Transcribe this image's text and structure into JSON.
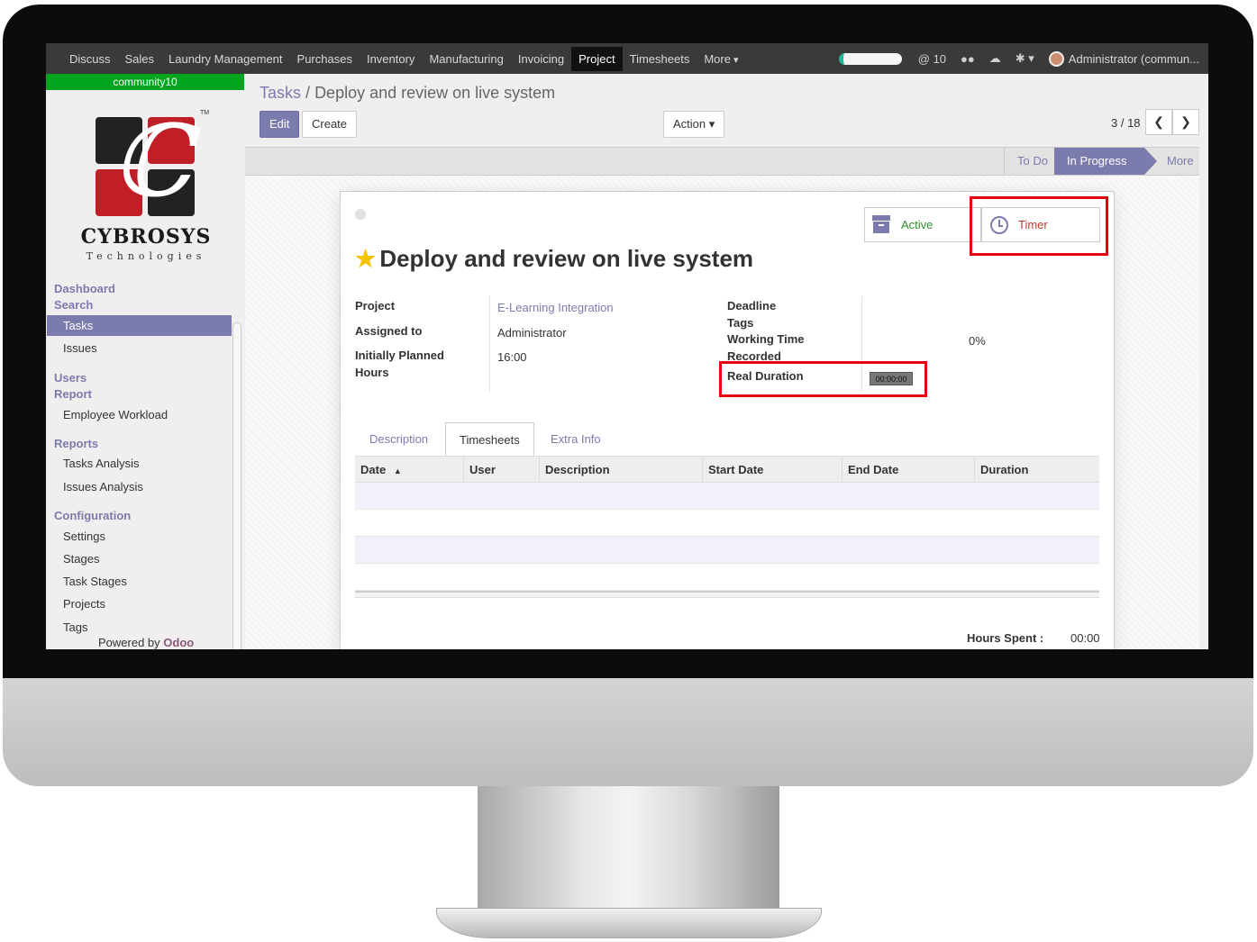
{
  "topbar": {
    "menu": [
      "Discuss",
      "Sales",
      "Laundry Management",
      "Purchases",
      "Inventory",
      "Manufacturing",
      "Invoicing",
      "Project",
      "Timesheets",
      "More"
    ],
    "active_menu": "Project",
    "mentions_count": "@ 10",
    "user": "Administrator (commun..."
  },
  "sidebar": {
    "db_name": "community10",
    "brand": "CYBROSYS",
    "brand_sub": "Technologies",
    "tm": "TM",
    "sections": {
      "dashboard": "Dashboard",
      "search": "Search",
      "users": "Users",
      "report": "Report",
      "reports": "Reports",
      "configuration": "Configuration"
    },
    "items": {
      "tasks": "Tasks",
      "issues": "Issues",
      "employee_workload": "Employee Workload",
      "tasks_analysis": "Tasks Analysis",
      "issues_analysis": "Issues Analysis",
      "settings": "Settings",
      "stages": "Stages",
      "task_stages": "Task Stages",
      "projects": "Projects",
      "tags": "Tags"
    },
    "powered_by": "Powered by",
    "powered_brand": "Odoo"
  },
  "control": {
    "breadcrumb_link": "Tasks",
    "breadcrumb_sep": "/",
    "breadcrumb_current": "Deploy and review on live system",
    "edit": "Edit",
    "create": "Create",
    "action": "Action",
    "pager": "3 / 18"
  },
  "stages": {
    "todo": "To Do",
    "in_progress": "In Progress",
    "more": "More"
  },
  "form": {
    "active_button": "Active",
    "timer_button": "Timer",
    "title": "Deploy and review on live system",
    "labels": {
      "project": "Project",
      "assigned_to": "Assigned to",
      "planned_1": "Initially Planned",
      "planned_2": "Hours",
      "deadline": "Deadline",
      "tags": "Tags",
      "working_time": "Working Time",
      "recorded": "Recorded",
      "real_duration": "Real Duration"
    },
    "values": {
      "project": "E-Learning Integration",
      "assigned_to": "Administrator",
      "planned_hours": "16:00",
      "working_time_pct": "0%",
      "real_duration": "00:00:00"
    },
    "tabs": [
      "Description",
      "Timesheets",
      "Extra Info"
    ],
    "active_tab": "Timesheets",
    "columns": [
      "Date",
      "User",
      "Description",
      "Start Date",
      "End Date",
      "Duration"
    ],
    "hours_spent_label": "Hours Spent :",
    "hours_spent_value": "00:00"
  },
  "colors": {
    "accent": "#7c7bad",
    "highlight": "#e3000f",
    "db_badge": "#00a51d"
  }
}
